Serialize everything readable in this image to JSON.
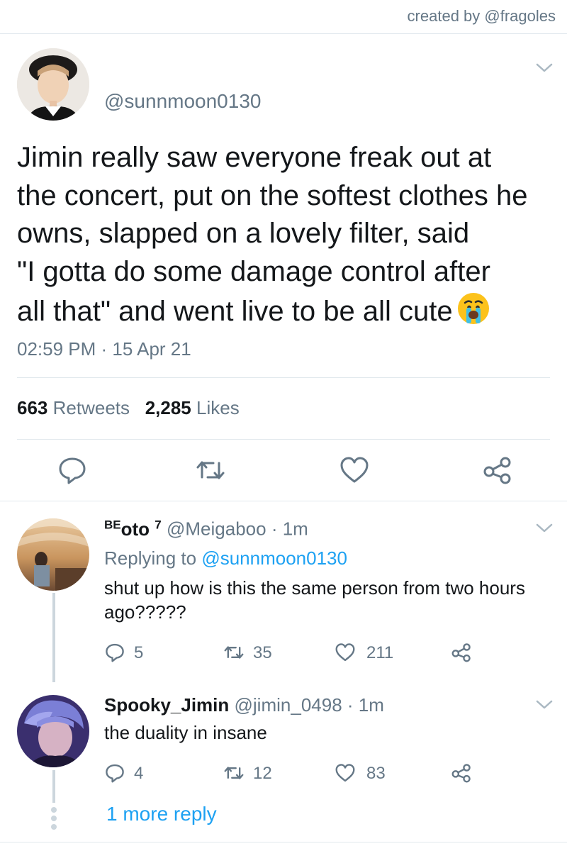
{
  "credit": "created by @fragoles",
  "tweet": {
    "handle": "@sunnmoon0130",
    "text": "Jimin really saw everyone freak out at\nthe concert, put on the softest clothes he\nowns, slapped on a lovely filter, said\n\"I gotta do some damage control after\nall that\" and went live to be all cute",
    "emoji": "crying-face-emoji",
    "time": "02:59 PM",
    "separator": " · ",
    "date": "15 Apr 21",
    "retweets_count": "663",
    "retweets_label": "Retweets",
    "likes_count": "2,285",
    "likes_label": "Likes",
    "actions": [
      "reply-icon",
      "retweet-icon",
      "like-icon",
      "share-icon"
    ]
  },
  "replies": [
    {
      "name": "BEoto",
      "name_sup_prefix": "BE",
      "name_main": "oto",
      "name_sup_suffix": "7",
      "handle": "@Meigaboo",
      "time": "· 1m",
      "replying_label": "Replying to",
      "replying_to": "@sunnmoon0130",
      "text": "shut up how is this the same person from two hours ago?????",
      "reply_count": "5",
      "retweet_count": "35",
      "like_count": "211"
    },
    {
      "name": "Spooky_Jimin",
      "handle": "@jimin_0498",
      "time": "· 1m",
      "text": "the duality in insane",
      "reply_count": "4",
      "retweet_count": "12",
      "like_count": "83"
    }
  ],
  "more_replies": "1 more reply",
  "colors": {
    "accent": "#1da1f2",
    "secondary_text": "#657786",
    "divider": "#e1e8ed",
    "thread_line": "#ccd6dd"
  }
}
